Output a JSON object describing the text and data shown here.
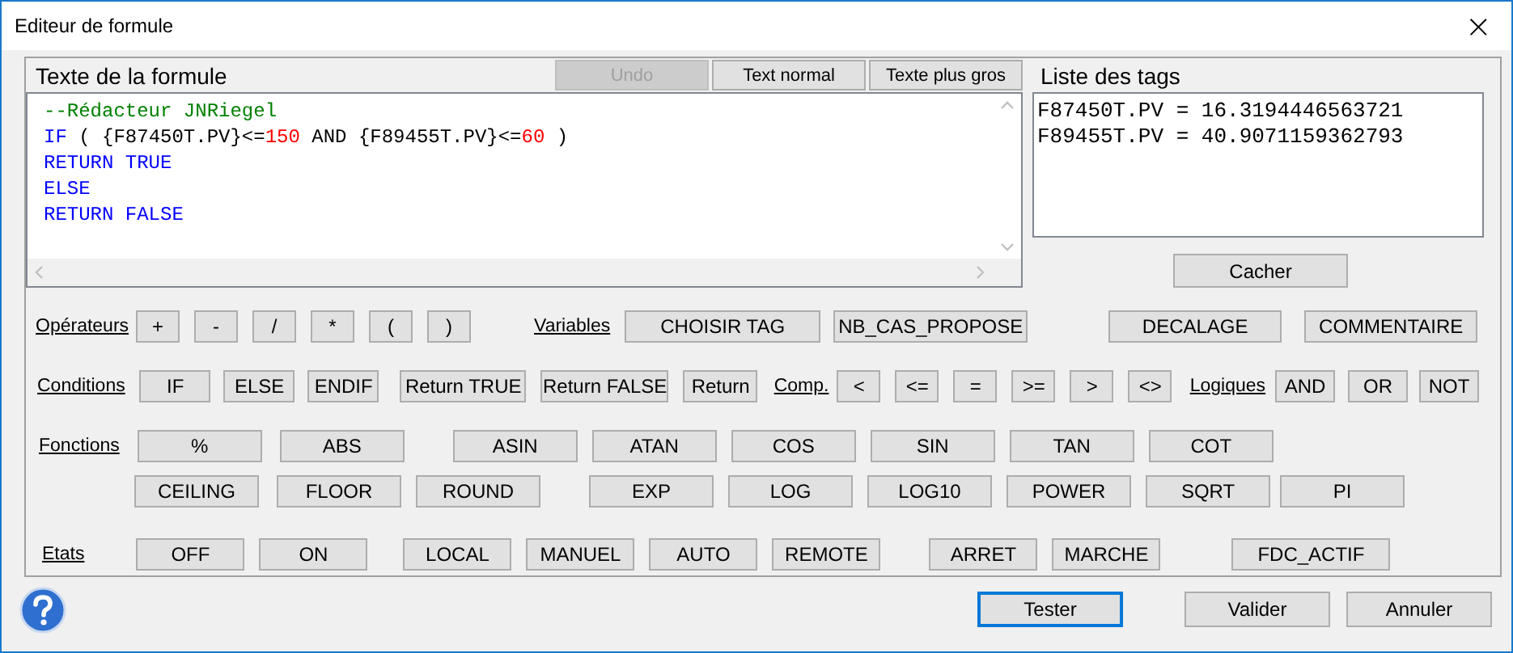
{
  "window": {
    "title": "Editeur de formule",
    "close": "×"
  },
  "formula": {
    "label": "Texte de la formule",
    "buttons": [
      {
        "label": "Undo",
        "disabled": true
      },
      {
        "label": "Text normal",
        "disabled": false
      },
      {
        "label": "Texte plus gros",
        "disabled": false
      }
    ],
    "lines": [
      [
        {
          "text": "--Rédacteur JNRiegel",
          "kind": "comment"
        }
      ],
      [
        {
          "text": "IF",
          "kind": "keyword"
        },
        {
          "text": " ( {F87450T.PV}<=",
          "kind": "plain"
        },
        {
          "text": "150",
          "kind": "number"
        },
        {
          "text": " AND {F89455T.PV}<=",
          "kind": "plain"
        },
        {
          "text": "60",
          "kind": "number"
        },
        {
          "text": " )",
          "kind": "plain"
        }
      ],
      [
        {
          "text": "RETURN TRUE",
          "kind": "keyword"
        }
      ],
      [
        {
          "text": "ELSE",
          "kind": "keyword"
        }
      ],
      [
        {
          "text": "RETURN FALSE",
          "kind": "keyword"
        }
      ]
    ]
  },
  "tags": {
    "label": "Liste des tags",
    "lines": [
      "F87450T.PV = 16.3194446563721",
      "F89455T.PV = 40.9071159362793"
    ],
    "hide_button": "Cacher"
  },
  "rows": [
    {
      "items": [
        {
          "kind": "label",
          "text": "Opérateurs"
        },
        {
          "kind": "button",
          "text": "+"
        },
        {
          "kind": "button",
          "text": "-"
        },
        {
          "kind": "button",
          "text": "/"
        },
        {
          "kind": "button",
          "text": "*"
        },
        {
          "kind": "button",
          "text": "("
        },
        {
          "kind": "button",
          "text": ")"
        },
        {
          "kind": "label",
          "text": "Variables"
        },
        {
          "kind": "button",
          "text": "CHOISIR TAG"
        },
        {
          "kind": "button",
          "text": "NB_CAS_PROPOSE"
        },
        {
          "kind": "button",
          "text": "DECALAGE"
        },
        {
          "kind": "button",
          "text": "COMMENTAIRE"
        }
      ]
    },
    {
      "items": [
        {
          "kind": "label",
          "text": "Conditions"
        },
        {
          "kind": "button",
          "text": "IF"
        },
        {
          "kind": "button",
          "text": "ELSE"
        },
        {
          "kind": "button",
          "text": "ENDIF"
        },
        {
          "kind": "button",
          "text": "Return TRUE"
        },
        {
          "kind": "button",
          "text": "Return FALSE"
        },
        {
          "kind": "button",
          "text": "Return"
        },
        {
          "kind": "label",
          "text": "Comp."
        },
        {
          "kind": "button",
          "text": "<"
        },
        {
          "kind": "button",
          "text": "<="
        },
        {
          "kind": "button",
          "text": "="
        },
        {
          "kind": "button",
          "text": ">="
        },
        {
          "kind": "button",
          "text": ">"
        },
        {
          "kind": "button",
          "text": "<>"
        },
        {
          "kind": "label",
          "text": "Logiques"
        },
        {
          "kind": "button",
          "text": "AND"
        },
        {
          "kind": "button",
          "text": "OR"
        },
        {
          "kind": "button",
          "text": "NOT"
        }
      ]
    },
    {
      "items": [
        {
          "kind": "label",
          "text": "Fonctions"
        },
        {
          "kind": "button",
          "text": "%"
        },
        {
          "kind": "button",
          "text": "ABS"
        },
        {
          "kind": "button",
          "text": "ASIN"
        },
        {
          "kind": "button",
          "text": "ATAN"
        },
        {
          "kind": "button",
          "text": "COS"
        },
        {
          "kind": "button",
          "text": "SIN"
        },
        {
          "kind": "button",
          "text": "TAN"
        },
        {
          "kind": "button",
          "text": "COT"
        }
      ]
    },
    {
      "items": [
        {
          "kind": "button",
          "text": "CEILING"
        },
        {
          "kind": "button",
          "text": "FLOOR"
        },
        {
          "kind": "button",
          "text": "ROUND"
        },
        {
          "kind": "button",
          "text": "EXP"
        },
        {
          "kind": "button",
          "text": "LOG"
        },
        {
          "kind": "button",
          "text": "LOG10"
        },
        {
          "kind": "button",
          "text": "POWER"
        },
        {
          "kind": "button",
          "text": "SQRT"
        },
        {
          "kind": "button",
          "text": "PI"
        }
      ]
    },
    {
      "items": [
        {
          "kind": "label",
          "text": "Etats"
        },
        {
          "kind": "button",
          "text": "OFF"
        },
        {
          "kind": "button",
          "text": "ON"
        },
        {
          "kind": "button",
          "text": "LOCAL"
        },
        {
          "kind": "button",
          "text": "MANUEL"
        },
        {
          "kind": "button",
          "text": "AUTO"
        },
        {
          "kind": "button",
          "text": "REMOTE"
        },
        {
          "kind": "button",
          "text": "ARRET"
        },
        {
          "kind": "button",
          "text": "MARCHE"
        },
        {
          "kind": "button",
          "text": "FDC_ACTIF"
        }
      ]
    }
  ],
  "footer": {
    "buttons": [
      {
        "label": "Tester",
        "default": true
      },
      {
        "label": "Valider",
        "default": false
      },
      {
        "label": "Annuler",
        "default": false
      }
    ]
  }
}
